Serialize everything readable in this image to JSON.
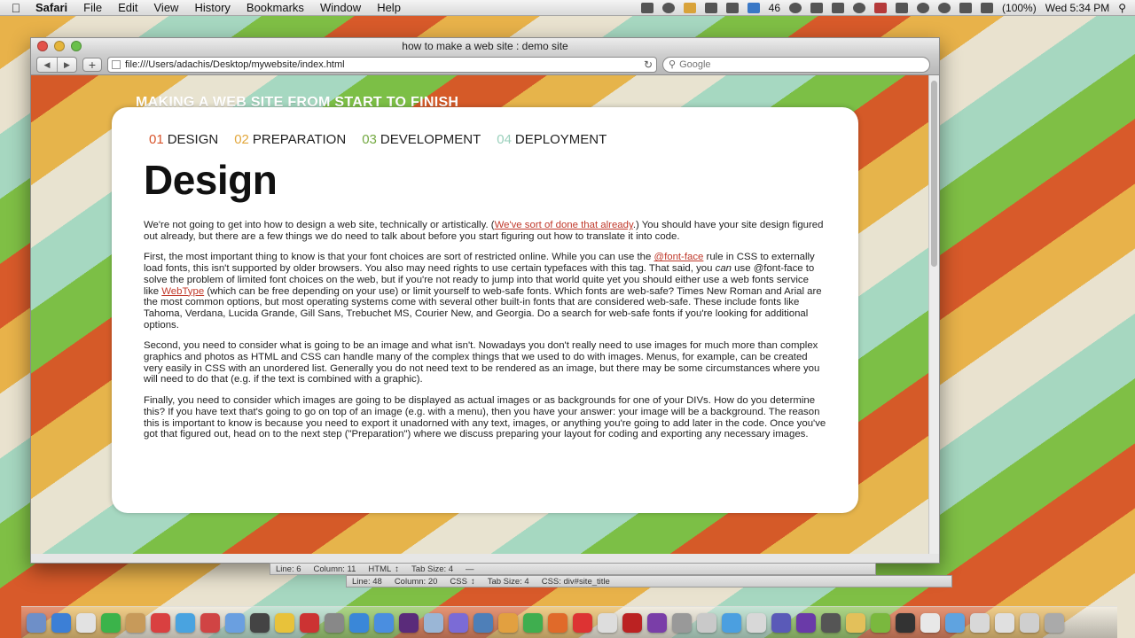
{
  "menubar": {
    "apple_icon": "apple-icon",
    "app_name": "Safari",
    "menus": [
      "File",
      "Edit",
      "View",
      "History",
      "Bookmarks",
      "Window",
      "Help"
    ],
    "status": {
      "mail_count": "46",
      "battery": "(100%)",
      "clock": "Wed 5:34 PM"
    }
  },
  "window": {
    "title": "how to make a web site : demo site",
    "url": "file:///Users/adachis/Desktop/mywebsite/index.html",
    "search_placeholder": "Google"
  },
  "page": {
    "site_title": "MAKING A WEB SITE FROM START TO FINISH",
    "steps": [
      {
        "num": "01",
        "label": "DESIGN",
        "color": "#d8542b"
      },
      {
        "num": "02",
        "label": "PREPARATION",
        "color": "#e2a73c"
      },
      {
        "num": "03",
        "label": "DEVELOPMENT",
        "color": "#74a942"
      },
      {
        "num": "04",
        "label": "DEPLOYMENT",
        "color": "#9ad0bc"
      }
    ],
    "heading": "Design",
    "p1": {
      "a": "We're not going to get into how to design a web site, technically or artistically. (",
      "link": "We've sort of done that already",
      "b": ".) You should have your site design figured out already, but there are a few things we do need to talk about before you start figuring out how to translate it into code."
    },
    "p2": {
      "a": "First, the most important thing to know is that your font choices are sort of restricted online. While you can use the ",
      "link1": "@font-face",
      "b": " rule in CSS to externally load fonts, this isn't supported by older browsers. You also may need rights to use certain typefaces with this tag. That said, you ",
      "em": "can",
      "c": " use @font-face to solve the problem of limited font choices on the web, but if you're not ready to jump into that world quite yet you should either use a web fonts service like ",
      "link2": "WebType",
      "d": " (which can be free depending on your use) or limit yourself to web-safe fonts. Which fonts are web-safe? Times New Roman and Arial are the most common options, but most operating systems come with several other built-in fonts that are considered web-safe. These include fonts like Tahoma, Verdana, Lucida Grande, Gill Sans, Trebuchet MS, Courier New, and Georgia. Do a search for web-safe fonts if you're looking for additional options."
    },
    "p3": "Second, you need to consider what is going to be an image and what isn't. Nowadays you don't really need to use images for much more than complex graphics and photos as HTML and CSS can handle many of the complex things that we used to do with images. Menus, for example, can be created very easily in CSS with an unordered list. Generally you do not need text to be rendered as an image, but there may be some circumstances where you will need to do that (e.g. if the text is combined with a graphic).",
    "p4": "Finally, you need to consider which images are going to be displayed as actual images or as backgrounds for one of your DIVs. How do you determine this? If you have text that's going to go on top of an image (e.g. with a menu), then you have your answer: your image will be a background. The reason this is important to know is because you need to export it unadorned with any text, images, or anything you're going to add later in the code. Once you've got that figured out, head on to the next step (\"Preparation\") where we discuss preparing your layout for coding and exporting any necessary images."
  },
  "editor_status_1": {
    "line": "Line: 6",
    "column": "Column: 11",
    "language": "HTML",
    "tab_size": "Tab Size:  4",
    "symbol": "—"
  },
  "editor_status_2": {
    "line": "Line: 48",
    "column": "Column: 20",
    "language": "CSS",
    "tab_size": "Tab Size:  4",
    "symbol": "CSS: div#site_title"
  },
  "colors": {
    "link": "#c0392b",
    "card": "#ffffff"
  }
}
